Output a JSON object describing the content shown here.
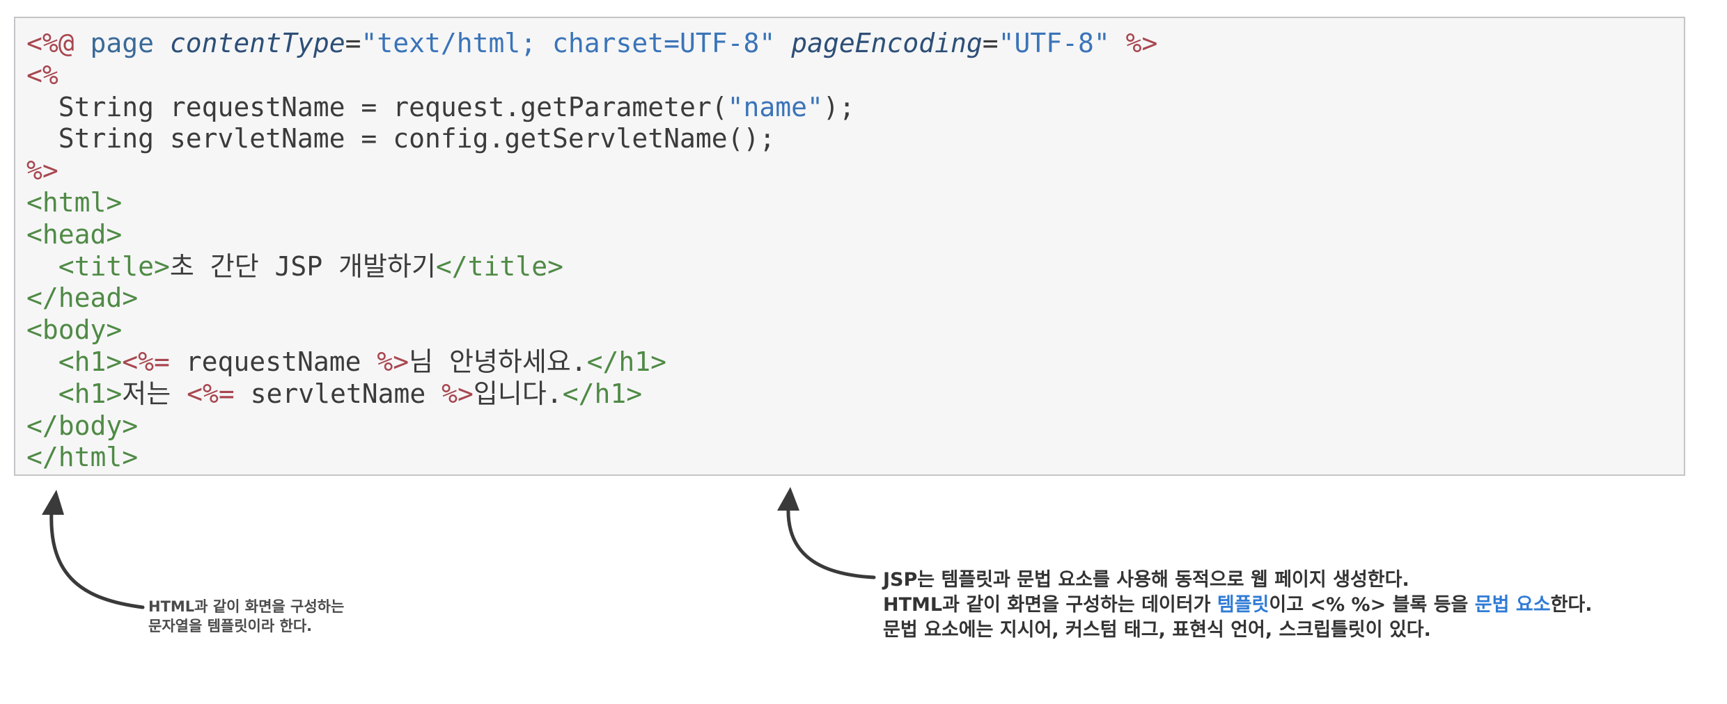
{
  "code": {
    "line1": {
      "open": "<%@",
      "directive": " page ",
      "attr1": "contentType",
      "eq1": "=",
      "val1": "\"text/html; charset=UTF-8\"",
      "sp": " ",
      "attr2": "pageEncoding",
      "eq2": "=",
      "val2": "\"UTF-8\"",
      "close": " %>"
    },
    "line2": {
      "open": "<%"
    },
    "line3": {
      "before": "  String requestName = request.getParameter(",
      "str": "\"name\"",
      "after": ");"
    },
    "line4": {
      "text": "  String servletName = config.getServletName();"
    },
    "line5": {
      "close": "%>"
    },
    "line6": {
      "tag": "<html>"
    },
    "line7": {
      "tag": "<head>"
    },
    "line8": {
      "indent": "  ",
      "open": "<title>",
      "text": "초 간단 JSP 개발하기",
      "close": "</title>"
    },
    "line9": {
      "tag": "</head>"
    },
    "line10": {
      "tag": "<body>"
    },
    "line11": {
      "indent": "  ",
      "open": "<h1>",
      "expr_open": "<%=",
      "expr": " requestName ",
      "expr_close": "%>",
      "text": "님 안녕하세요.",
      "close": "</h1>"
    },
    "line12": {
      "indent": "  ",
      "open": "<h1>",
      "text_before": "저는 ",
      "expr_open": "<%=",
      "expr": " servletName ",
      "expr_close": "%>",
      "text": "입니다.",
      "close": "</h1>"
    },
    "line13": {
      "tag": "</body>"
    },
    "line14": {
      "tag": "</html>"
    }
  },
  "annotations": {
    "left": {
      "line1": "HTML과 같이 화면을 구성하는",
      "line2": "문자열을 템플릿이라 한다."
    },
    "right": {
      "line1": "JSP는 템플릿과 문법 요소를 사용해 동적으로 웹 페이지 생성한다.",
      "line2_a": "HTML과 같이 화면을 구성하는 데이터가 ",
      "line2_hl1": "템플릿",
      "line2_b": "이고 <% %> 블록 등을 ",
      "line2_hl2": "문법 요소",
      "line2_c": "한다.",
      "line3": "문법 요소에는 지시어, 커스텀 태그, 표현식 언어, 스크립틀릿이 있다."
    }
  },
  "colors": {
    "delimiter": "#a8474f",
    "tag": "#4f8a45",
    "keyword": "#3a6a97",
    "string": "#3a74b8",
    "highlight": "#2f7bd6"
  }
}
